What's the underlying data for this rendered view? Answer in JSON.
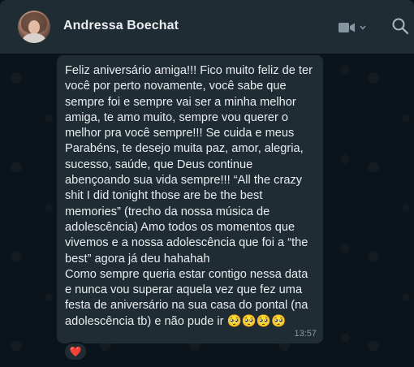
{
  "header": {
    "contact_name": "Andressa Boechat"
  },
  "icons": {
    "video": "video-camera-icon",
    "chevron": "chevron-down-icon",
    "search": "search-icon"
  },
  "message": {
    "text": "Feliz aniversário amiga!!! Fico muito feliz de ter você por perto novamente, você sabe que sempre foi e sempre vai ser a minha melhor amiga, te amo muito, sempre vou querer o melhor pra você sempre!!! Se cuida e meus Parabéns, te desejo muita paz, amor, alegria, sucesso, saúde, que Deus continue abençoando sua vida sempre!!! “All the crazy shit I did tonight those are be the best memories” (trecho da nossa música de adolescência) Amo todos os momentos que vivemos e a nossa adolescência que foi a “the best” agora já deu hahahah\nComo sempre queria estar contigo nessa data e nunca vou superar aquela vez que fez uma festa de aniversário na sua casa do pontal (na adolescência tb) e não pude ir 🥺🥺🥺🥺",
    "time": "13:57"
  },
  "reaction": {
    "emoji": "❤️"
  },
  "colors": {
    "header_bg": "#202c33",
    "chat_bg": "#0b141a",
    "bubble_bg": "#202c33",
    "text": "#e9edef",
    "muted": "#8696a0"
  }
}
